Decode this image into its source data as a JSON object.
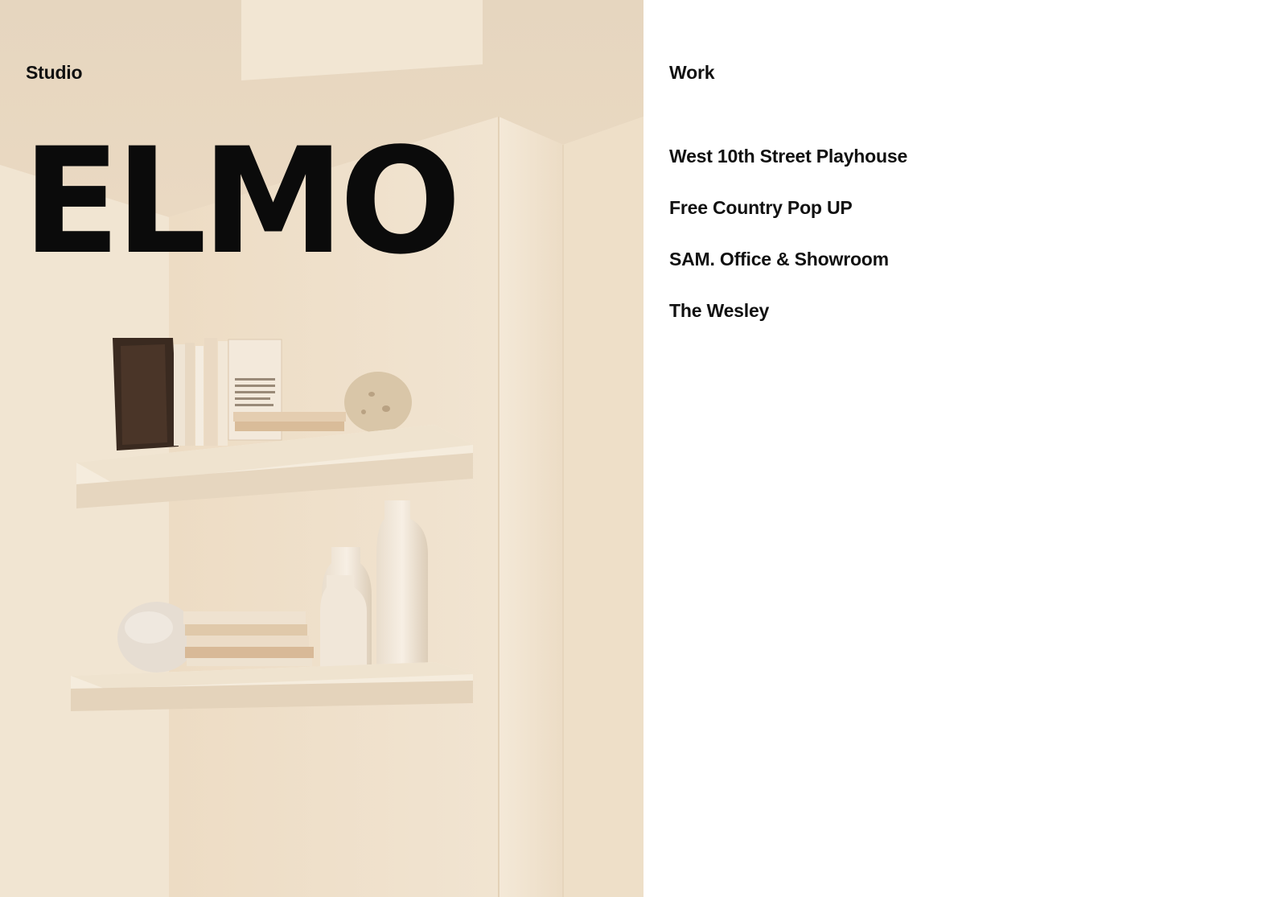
{
  "studio": {
    "nav_label": "Studio",
    "brand": "ELMO"
  },
  "work": {
    "heading": "Work",
    "projects": [
      {
        "title": "West 10th Street Playhouse"
      },
      {
        "title": "Free Country Pop UP"
      },
      {
        "title": "SAM. Office & Showroom"
      },
      {
        "title": "The Wesley"
      }
    ]
  },
  "hero_image": {
    "subject": "shelves-with-books-and-vases-photo",
    "wall_color": "#efe3d1",
    "shelf_color": "#f3ead9"
  }
}
